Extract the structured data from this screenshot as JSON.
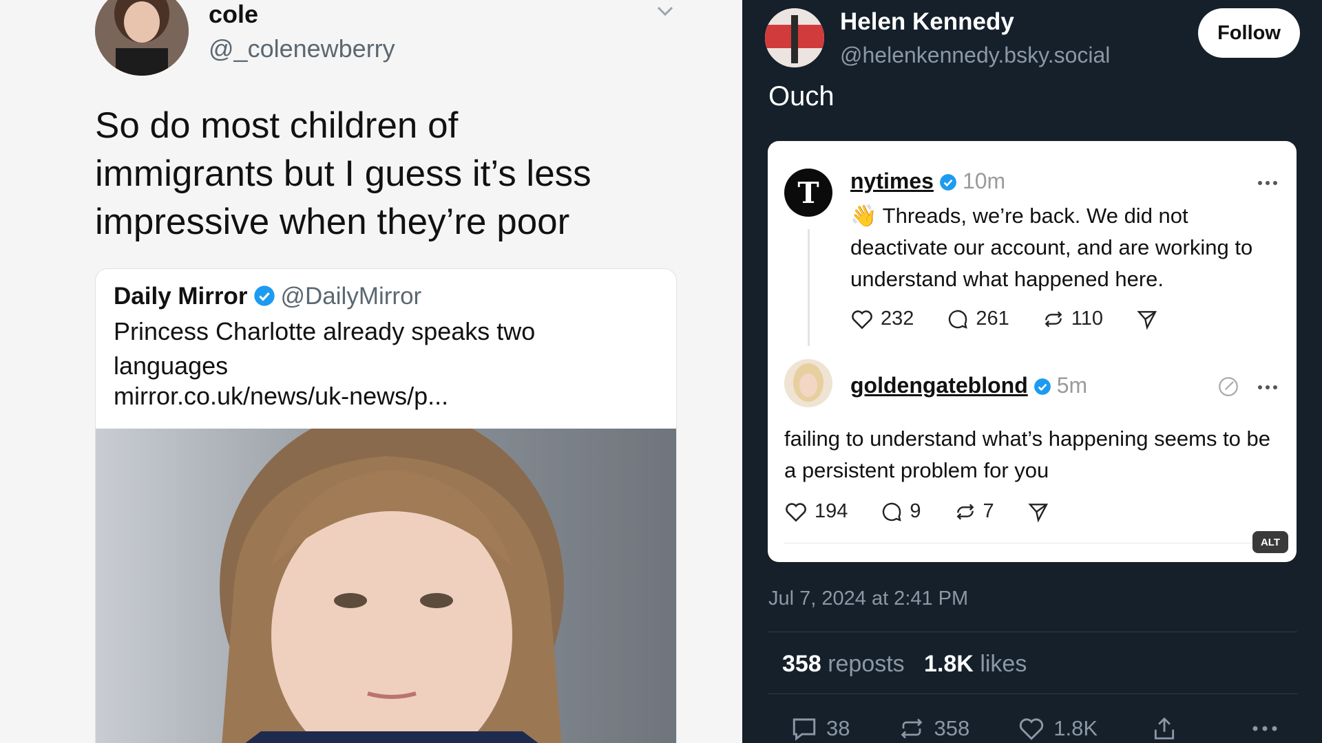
{
  "left_tweet": {
    "author_name": "cole",
    "author_handle": "@_colenewberry",
    "text": "So do most children of immigrants but I guess it’s less impressive when they’re poor",
    "quoted": {
      "author_name": "Daily Mirror",
      "author_handle": "@DailyMirror",
      "text": "Princess Charlotte already speaks two languages",
      "link": "mirror.co.uk/news/uk-news/p..."
    }
  },
  "right_post": {
    "author_name": "Helen Kennedy",
    "author_handle": "@helenkennedy.bsky.social",
    "follow_label": "Follow",
    "text": "Ouch",
    "embed": {
      "post1": {
        "user": "nytimes",
        "time": "10m",
        "emoji": "👋",
        "text": "Threads, we’re back. We did not deactivate our account, and are working to understand what happened here.",
        "likes": "232",
        "replies": "261",
        "reposts": "110"
      },
      "post2": {
        "user": "goldengateblond",
        "time": "5m",
        "text": "failing to understand what’s happening seems to be a persistent problem for you",
        "likes": "194",
        "replies": "9",
        "reposts": "7"
      },
      "alt_label": "ALT"
    },
    "date": "Jul 7, 2024 at 2:41 PM",
    "stats": {
      "reposts_count": "358",
      "reposts_label": "reposts",
      "likes_count": "1.8K",
      "likes_label": "likes"
    },
    "actions": {
      "replies": "38",
      "reposts": "358",
      "likes": "1.8K"
    }
  },
  "icons": [
    "verified-badge-icon",
    "chevron-down-icon",
    "heart-icon",
    "comment-icon",
    "repost-icon",
    "share-icon",
    "more-icon"
  ],
  "colors": {
    "verified": "#1d9bf0",
    "bluesky_bg": "#15202b",
    "twitter_bg": "#f5f5f5"
  }
}
